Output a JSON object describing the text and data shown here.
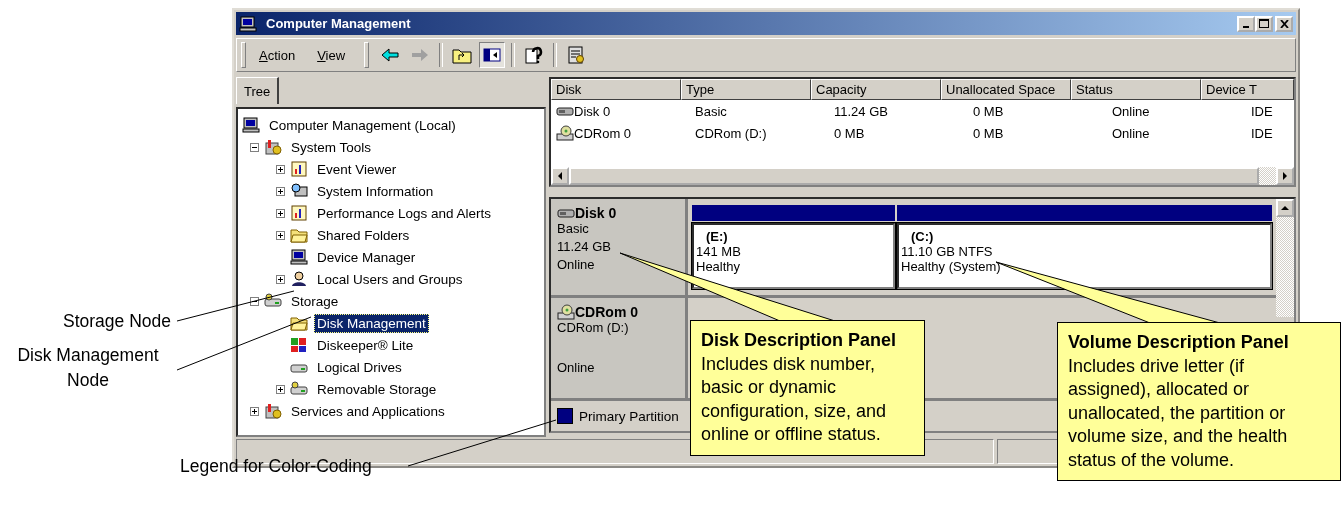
{
  "window": {
    "title": "Computer Management"
  },
  "menus": [
    {
      "label": "Action"
    },
    {
      "label": "View"
    }
  ],
  "toolbar": [
    {
      "kind": "back",
      "disabled": false
    },
    {
      "kind": "forward",
      "disabled": true
    },
    {
      "kind": "sep"
    },
    {
      "kind": "up"
    },
    {
      "kind": "tree",
      "pressed": true
    },
    {
      "kind": "sep"
    },
    {
      "kind": "help"
    },
    {
      "kind": "sep"
    },
    {
      "kind": "properties"
    }
  ],
  "tabs": [
    {
      "label": "Tree",
      "selected": true
    }
  ],
  "tree": [
    {
      "label": "Computer Management (Local)",
      "selected": false,
      "children": [
        {
          "label": "System Tools",
          "kind": "branch",
          "expanded": true,
          "selected": false,
          "children": [
            {
              "label": "Event Viewer",
              "kind": "branch",
              "expanded": false,
              "selected": false
            },
            {
              "label": "System Information",
              "kind": "branch",
              "expanded": false,
              "selected": false
            },
            {
              "label": "Performance Logs and Alerts",
              "kind": "branch",
              "expanded": false,
              "selected": false
            },
            {
              "label": "Shared Folders",
              "kind": "branch",
              "expanded": false,
              "selected": false
            },
            {
              "label": "Device Manager",
              "kind": "leaf",
              "selected": false
            },
            {
              "label": "Local Users and Groups",
              "kind": "branch",
              "expanded": false,
              "selected": false
            }
          ]
        },
        {
          "label": "Storage",
          "kind": "branch",
          "expanded": true,
          "selected": false,
          "children": [
            {
              "label": "Disk Management",
              "kind": "leaf",
              "selected": true
            },
            {
              "label": "Diskeeper® Lite",
              "kind": "leaf",
              "selected": false
            },
            {
              "label": "Logical Drives",
              "kind": "leaf",
              "selected": false
            },
            {
              "label": "Removable Storage",
              "kind": "branch",
              "expanded": false,
              "selected": false
            }
          ]
        },
        {
          "label": "Services and Applications",
          "kind": "branch",
          "expanded": false,
          "selected": false
        }
      ]
    }
  ],
  "table": {
    "columns": [
      "Disk",
      "Type",
      "Capacity",
      "Unallocated Space",
      "Status",
      "Device T"
    ],
    "rows": [
      {
        "kind": "disk",
        "cells": [
          "Disk 0",
          "Basic",
          "11.24 GB",
          "0 MB",
          "Online",
          "IDE"
        ]
      },
      {
        "kind": "cdrom",
        "cells": [
          "CDRom 0",
          "CDRom (D:)",
          "0 MB",
          "0 MB",
          "Online",
          "IDE"
        ]
      }
    ]
  },
  "disks": [
    {
      "kind": "disk",
      "name": "Disk 0",
      "type": "Basic",
      "capacity": "11.24 GB",
      "status": "Online",
      "partitions": [
        {
          "letter": "(E:)",
          "size": "141 MB",
          "health": "Healthy",
          "color": "#000080"
        },
        {
          "letter": "(C:)",
          "size": "11.10 GB NTFS",
          "health": "Healthy (System)",
          "color": "#000080"
        }
      ]
    },
    {
      "kind": "cdrom",
      "name": "CDRom 0",
      "type": "CDRom (D:)",
      "status": "Online"
    }
  ],
  "legend": [
    {
      "label": "Primary Partition",
      "color": "#000080"
    }
  ],
  "callouts": [
    {
      "title": "Disk Description Panel",
      "body": "Includes disk number, basic or dynamic configuration, size, and online or offline status."
    },
    {
      "title": "Volume Description Panel",
      "body": "Includes drive letter (if assigned), allocated or unallocated, the partition or volume size, and the health status of the volume."
    }
  ],
  "annotations": [
    {
      "label": "Storage Node"
    },
    {
      "label": "Disk Management Node"
    },
    {
      "label": "Legend for Color-Coding"
    }
  ]
}
